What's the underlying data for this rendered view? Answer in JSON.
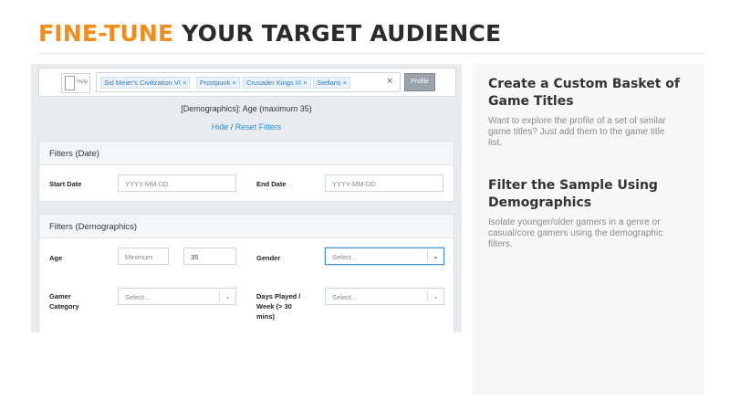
{
  "header": {
    "title_accent": "FINE-TUNE",
    "title_rest": " YOUR TARGET AUDIENCE"
  },
  "toolbar": {
    "help_label": "Help",
    "tags": [
      "Sid Meier's Civilization VI",
      "Frostpunk",
      "Crusader Kings III",
      "Stellaris"
    ],
    "tag_remove": "×",
    "clear_label": "×",
    "profile_label": "Profile"
  },
  "summary": {
    "text": "[Demographics]: Age (maximum 35)",
    "hide_link": "Hide",
    "separator": " / ",
    "reset_link": "Reset Filters"
  },
  "date_filters": {
    "title": "Filters (Date)",
    "start_label": "Start Date",
    "start_placeholder": "YYYY-MM-DD",
    "end_label": "End Date",
    "end_placeholder": "YYYY-MM-DD"
  },
  "demo_filters": {
    "title": "Filters (Demographics)",
    "age_label": "Age",
    "age_min_placeholder": "Minimum",
    "age_max_value": "35",
    "gender_label": "Gender",
    "gender_placeholder": "Select...",
    "gamer_category_label_1": "Gamer",
    "gamer_category_label_2": "Category",
    "gamer_category_placeholder": "Select...",
    "days_label_1": "Days Played /",
    "days_label_2": "Week (> 30",
    "days_label_3": "mins)",
    "days_placeholder": "Select..."
  },
  "sidebar": {
    "heading1_line1": "Create a Custom Basket of",
    "heading1_line2": "Game Titles",
    "body1_line1": "Want to explore the profile of a set of similar",
    "body1_line2": "game titles? Just add them to the game title",
    "body1_line3": "list.",
    "heading2_line1": "Filter the Sample Using",
    "heading2_line2": "Demographics",
    "body2_line1": "Isolate younger/older gamers in a genre or",
    "body2_line2": "casual/core gamers using the demographic",
    "body2_line3": "filters."
  },
  "colors": {
    "accent": "#f28c1b",
    "link": "#2a8fd6",
    "focus": "#4a8fd4"
  }
}
